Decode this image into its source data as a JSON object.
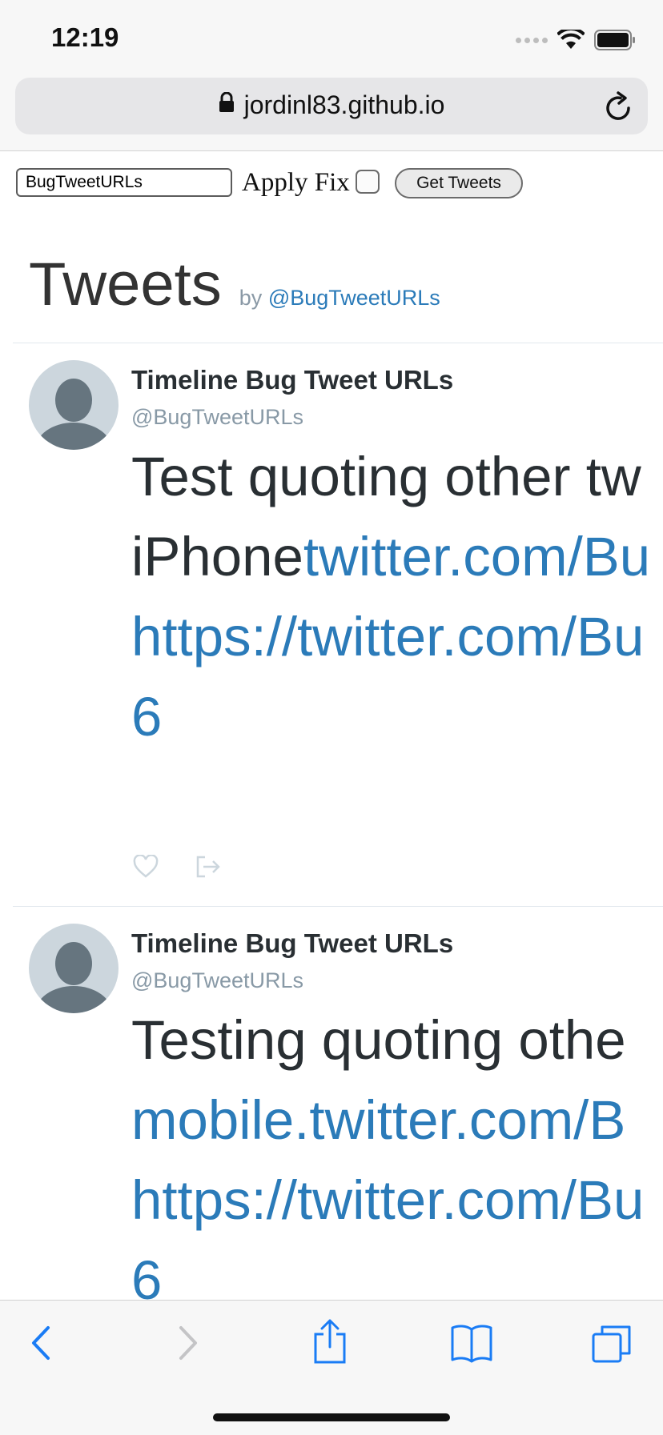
{
  "status_bar": {
    "time": "12:19"
  },
  "browser": {
    "url": "jordinl83.github.io"
  },
  "form": {
    "username_value": "BugTweetURLs",
    "apply_fix_label": "Apply Fix",
    "apply_fix_checked": false,
    "get_tweets_label": "Get Tweets"
  },
  "timeline": {
    "title": "Tweets",
    "by_prefix": "by",
    "by_handle": "@BugTweetURLs"
  },
  "tweets": [
    {
      "author": "Timeline Bug Tweet URLs",
      "handle": "@BugTweetURLs",
      "line1": "Test quoting other tw",
      "line2_text": "iPhone",
      "line2_link": "twitter.com/Bu",
      "line3_link": "https://twitter.com/Bu",
      "line4_link": "6"
    },
    {
      "author": "Timeline Bug Tweet URLs",
      "handle": "@BugTweetURLs",
      "line1": "Testing quoting othe",
      "line2_link": "mobile.twitter.com/B",
      "line3_link": "https://twitter.com/Bu",
      "line4_link": "6"
    }
  ],
  "colors": {
    "link": "#2b7bb9",
    "text": "#292f33",
    "handle": "#8899a6",
    "ios_blue": "#1a7cf5"
  }
}
